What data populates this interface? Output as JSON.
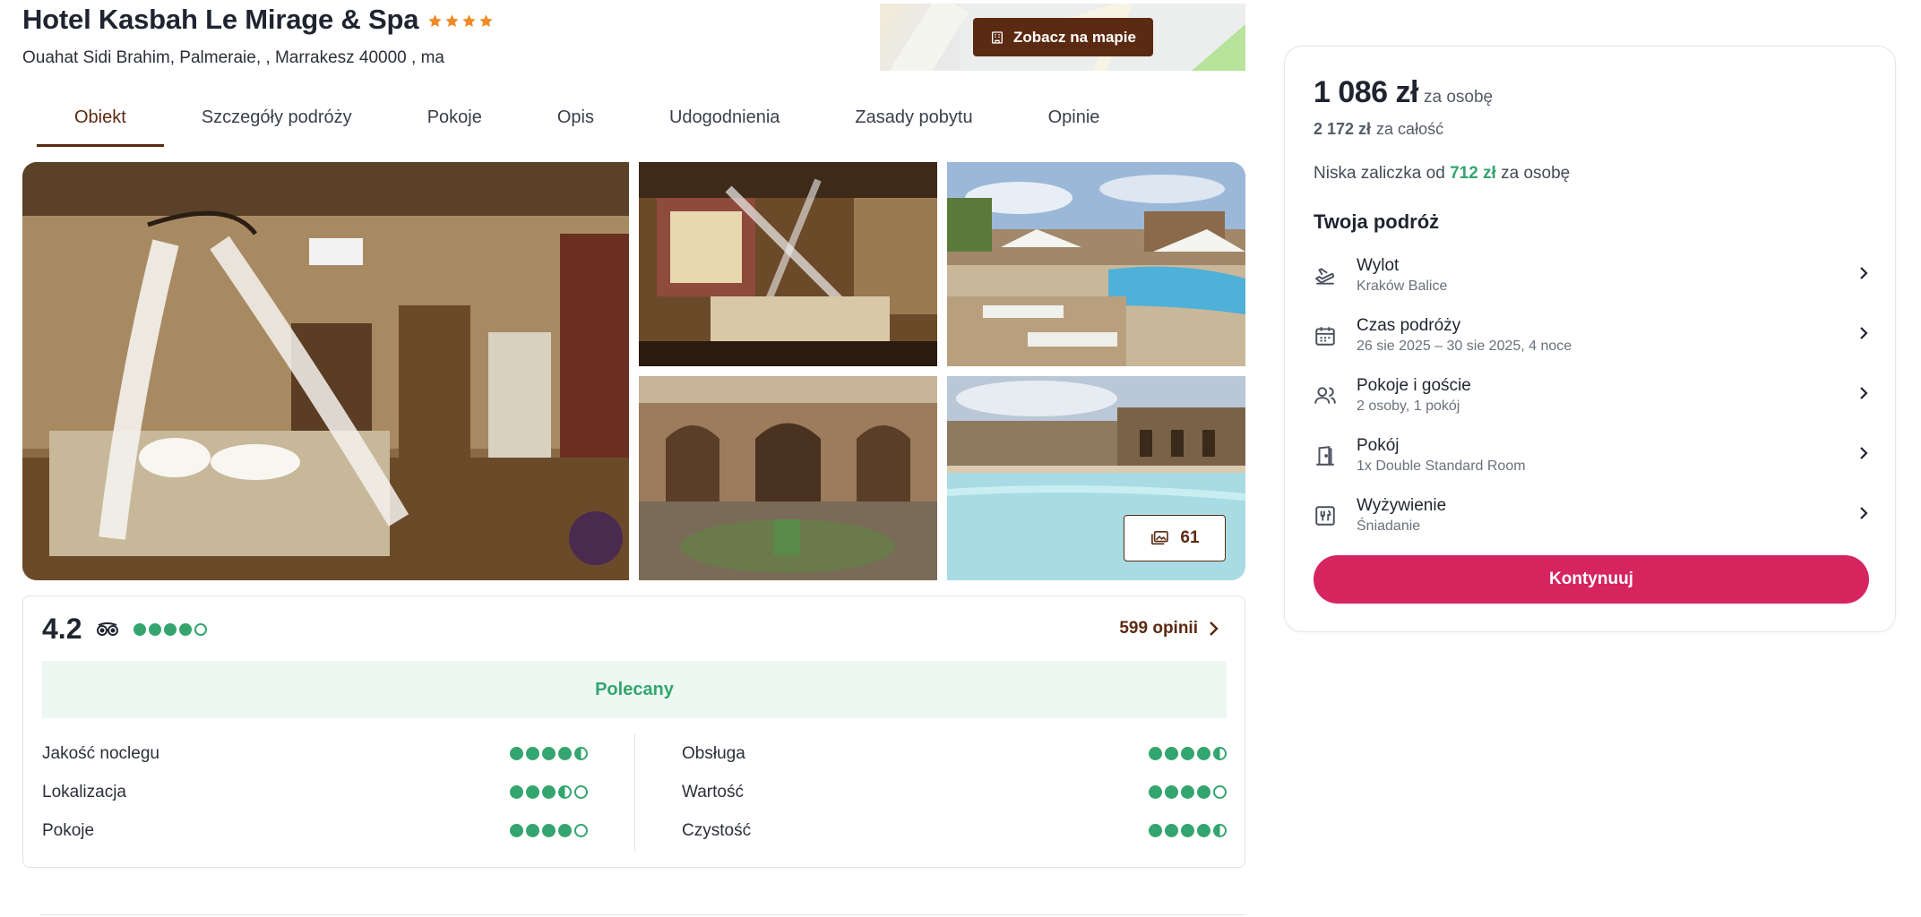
{
  "hotel": {
    "name": "Hotel Kasbah Le Mirage & Spa",
    "stars": 4,
    "address": "Ouahat Sidi Brahim, Palmeraie, , Marrakesz 40000 , ma"
  },
  "map": {
    "button_label": "Zobacz na mapie"
  },
  "tabs": [
    {
      "label": "Obiekt",
      "active": true
    },
    {
      "label": "Szczegóły podróży"
    },
    {
      "label": "Pokoje"
    },
    {
      "label": "Opis"
    },
    {
      "label": "Udogodnienia"
    },
    {
      "label": "Zasady pobytu"
    },
    {
      "label": "Opinie"
    }
  ],
  "gallery": {
    "photos": [
      "bedroom-canopy-bed",
      "bedroom-twin-beds",
      "pool-terrace-umbrellas",
      "riad-courtyard-arches",
      "pool-kasbah-walls"
    ],
    "photo_count": "61"
  },
  "reviews": {
    "score": "4.2",
    "overall_bubbles": 4,
    "link_label": "599 opinii",
    "recommended_label": "Polecany",
    "categories_left": [
      {
        "label": "Jakość noclegu",
        "rating": 4.5
      },
      {
        "label": "Lokalizacja",
        "rating": 3.5
      },
      {
        "label": "Pokoje",
        "rating": 4
      }
    ],
    "categories_right": [
      {
        "label": "Obsługa",
        "rating": 4.5
      },
      {
        "label": "Wartość",
        "rating": 4
      },
      {
        "label": "Czystość",
        "rating": 4.5
      }
    ]
  },
  "booking": {
    "price": "1 086 zł",
    "price_unit": "za osobę",
    "total": "2 172 zł",
    "total_unit": "za całość",
    "deposit_prefix": "Niska zaliczka od",
    "deposit_amount": "712 zł",
    "deposit_suffix": "za osobę",
    "trip_title": "Twoja podróż",
    "items": [
      {
        "icon": "plane-departure-icon",
        "label": "Wylot",
        "value": "Kraków Balice"
      },
      {
        "icon": "calendar-icon",
        "label": "Czas podróży",
        "value": "26 sie 2025 – 30 sie 2025, 4 noce"
      },
      {
        "icon": "guests-icon",
        "label": "Pokoje i goście",
        "value": "2 osoby, 1 pokój"
      },
      {
        "icon": "door-icon",
        "label": "Pokój",
        "value": "1x Double Standard Room"
      },
      {
        "icon": "cutlery-icon",
        "label": "Wyżywienie",
        "value": "Śniadanie"
      }
    ],
    "cta_label": "Kontynuuj"
  },
  "colors": {
    "brand_brown": "#5b2a12",
    "cta_pink": "#d6245f",
    "rating_green": "#34a56f",
    "star_orange": "#f08a24"
  }
}
